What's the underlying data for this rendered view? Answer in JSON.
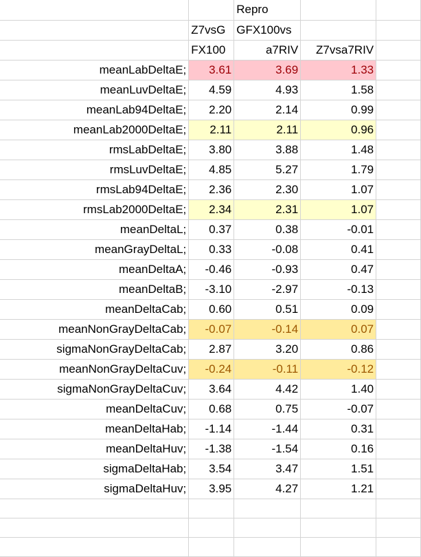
{
  "header": {
    "row1": {
      "b": "Repro"
    },
    "row2": {
      "a": "Z7vsG",
      "b": "GFX100vs"
    },
    "row3": {
      "a": "FX100",
      "b": "a7RIV",
      "c": "Z7vsa7RIV"
    }
  },
  "rows": [
    {
      "label": "meanLabDeltaE;",
      "a": "3.61",
      "b": "3.69",
      "c": "1.33",
      "highlight": "red"
    },
    {
      "label": "meanLuvDeltaE;",
      "a": "4.59",
      "b": "4.93",
      "c": "1.58",
      "highlight": "none"
    },
    {
      "label": "meanLab94DeltaE;",
      "a": "2.20",
      "b": "2.14",
      "c": "0.99",
      "highlight": "none"
    },
    {
      "label": "meanLab2000DeltaE;",
      "a": "2.11",
      "b": "2.11",
      "c": "0.96",
      "highlight": "yellow"
    },
    {
      "label": "rmsLabDeltaE;",
      "a": "3.80",
      "b": "3.88",
      "c": "1.48",
      "highlight": "none"
    },
    {
      "label": "rmsLuvDeltaE;",
      "a": "4.85",
      "b": "5.27",
      "c": "1.79",
      "highlight": "none"
    },
    {
      "label": "rmsLab94DeltaE;",
      "a": "2.36",
      "b": "2.30",
      "c": "1.07",
      "highlight": "none"
    },
    {
      "label": "rmsLab2000DeltaE;",
      "a": "2.34",
      "b": "2.31",
      "c": "1.07",
      "highlight": "yellow"
    },
    {
      "label": "meanDeltaL;",
      "a": "0.37",
      "b": "0.38",
      "c": "-0.01",
      "highlight": "none"
    },
    {
      "label": "meanGrayDeltaL;",
      "a": "0.33",
      "b": "-0.08",
      "c": "0.41",
      "highlight": "none"
    },
    {
      "label": "meanDeltaA;",
      "a": "-0.46",
      "b": "-0.93",
      "c": "0.47",
      "highlight": "none"
    },
    {
      "label": "meanDeltaB;",
      "a": "-3.10",
      "b": "-2.97",
      "c": "-0.13",
      "highlight": "none"
    },
    {
      "label": "meanDeltaCab;",
      "a": "0.60",
      "b": "0.51",
      "c": "0.09",
      "highlight": "none"
    },
    {
      "label": "meanNonGrayDeltaCab;",
      "a": "-0.07",
      "b": "-0.14",
      "c": "0.07",
      "highlight": "orange"
    },
    {
      "label": "sigmaNonGrayDeltaCab;",
      "a": "2.87",
      "b": "3.20",
      "c": "0.86",
      "highlight": "none"
    },
    {
      "label": "meanNonGrayDeltaCuv;",
      "a": "-0.24",
      "b": "-0.11",
      "c": "-0.12",
      "highlight": "orange"
    },
    {
      "label": "sigmaNonGrayDeltaCuv;",
      "a": "3.64",
      "b": "4.42",
      "c": "1.40",
      "highlight": "none"
    },
    {
      "label": "meanDeltaCuv;",
      "a": "0.68",
      "b": "0.75",
      "c": "-0.07",
      "highlight": "none"
    },
    {
      "label": "meanDeltaHab;",
      "a": "-1.14",
      "b": "-1.44",
      "c": "0.31",
      "highlight": "none"
    },
    {
      "label": "meanDeltaHuv;",
      "a": "-1.38",
      "b": "-1.54",
      "c": "0.16",
      "highlight": "none"
    },
    {
      "label": "sigmaDeltaHab;",
      "a": "3.54",
      "b": "3.47",
      "c": "1.51",
      "highlight": "none"
    },
    {
      "label": "sigmaDeltaHuv;",
      "a": "3.95",
      "b": "4.27",
      "c": "1.21",
      "highlight": "none"
    }
  ],
  "colors": {
    "red_fill": "#ffc7ce",
    "red_text": "#9c0006",
    "yellow_fill": "#ffffcc",
    "orange_fill": "#ffeb9c",
    "orange_text": "#9c5700",
    "gridline": "#d4d4d4"
  }
}
